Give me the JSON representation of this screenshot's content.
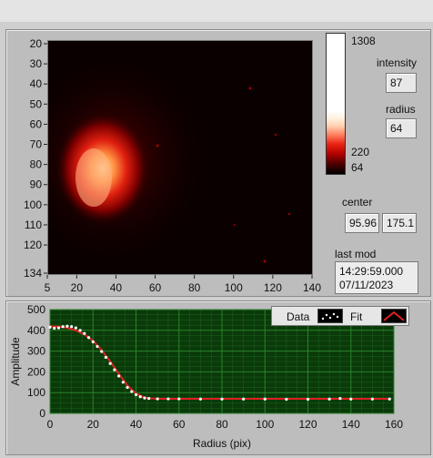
{
  "image_panel": {
    "y_ticks": [
      "20",
      "30",
      "40",
      "50",
      "60",
      "70",
      "80",
      "90",
      "100",
      "110",
      "120",
      "134"
    ],
    "x_ticks": [
      "5",
      "20",
      "40",
      "60",
      "80",
      "100",
      "120",
      "140"
    ]
  },
  "colorbar": {
    "max_label": "1308",
    "mid_label": "220",
    "min_label": "64"
  },
  "intensity": {
    "label": "intensity",
    "value": "87"
  },
  "radius": {
    "label": "radius",
    "value": "64"
  },
  "center": {
    "label": "center",
    "x": "95.96",
    "y": "175.1"
  },
  "last_mod": {
    "label": "last mod",
    "time": "14:29:59.000",
    "date": "07/11/2023"
  },
  "legend": {
    "data_label": "Data",
    "fit_label": "Fit"
  },
  "colors": {
    "plot_bg": "#0a3a0a",
    "grid": "#2e8a2e",
    "data_points": "#ffffff",
    "fit_line": "#e02020"
  },
  "chart_data": {
    "type": "line",
    "xlabel": "Radius (pix)",
    "ylabel": "Amplitude",
    "xlim": [
      0,
      160
    ],
    "ylim": [
      0,
      500
    ],
    "x_ticks": [
      0,
      20,
      40,
      60,
      80,
      100,
      120,
      140,
      160
    ],
    "y_ticks": [
      0,
      100,
      200,
      300,
      400,
      500
    ],
    "grid": true,
    "series": [
      {
        "name": "Data",
        "x": [
          0,
          2,
          4,
          6,
          8,
          10,
          12,
          14,
          16,
          18,
          20,
          22,
          24,
          26,
          28,
          30,
          32,
          34,
          36,
          38,
          40,
          42,
          44,
          46,
          50,
          55,
          60,
          70,
          80,
          90,
          100,
          110,
          120,
          130,
          135,
          140,
          150,
          158
        ],
        "y": [
          415,
          410,
          412,
          418,
          420,
          418,
          412,
          400,
          385,
          365,
          345,
          322,
          298,
          270,
          240,
          210,
          180,
          150,
          125,
          105,
          90,
          80,
          74,
          72,
          70,
          70,
          70,
          69,
          69,
          69,
          69,
          68,
          68,
          69,
          72,
          69,
          69,
          69
        ]
      },
      {
        "name": "Fit",
        "x": [
          0,
          4,
          8,
          12,
          16,
          20,
          24,
          28,
          32,
          36,
          40,
          44,
          48,
          52,
          60,
          80,
          100,
          120,
          140,
          158
        ],
        "y": [
          420,
          418,
          412,
          400,
          380,
          350,
          305,
          250,
          190,
          135,
          95,
          76,
          71,
          70,
          70,
          70,
          70,
          70,
          70,
          70
        ]
      }
    ]
  }
}
